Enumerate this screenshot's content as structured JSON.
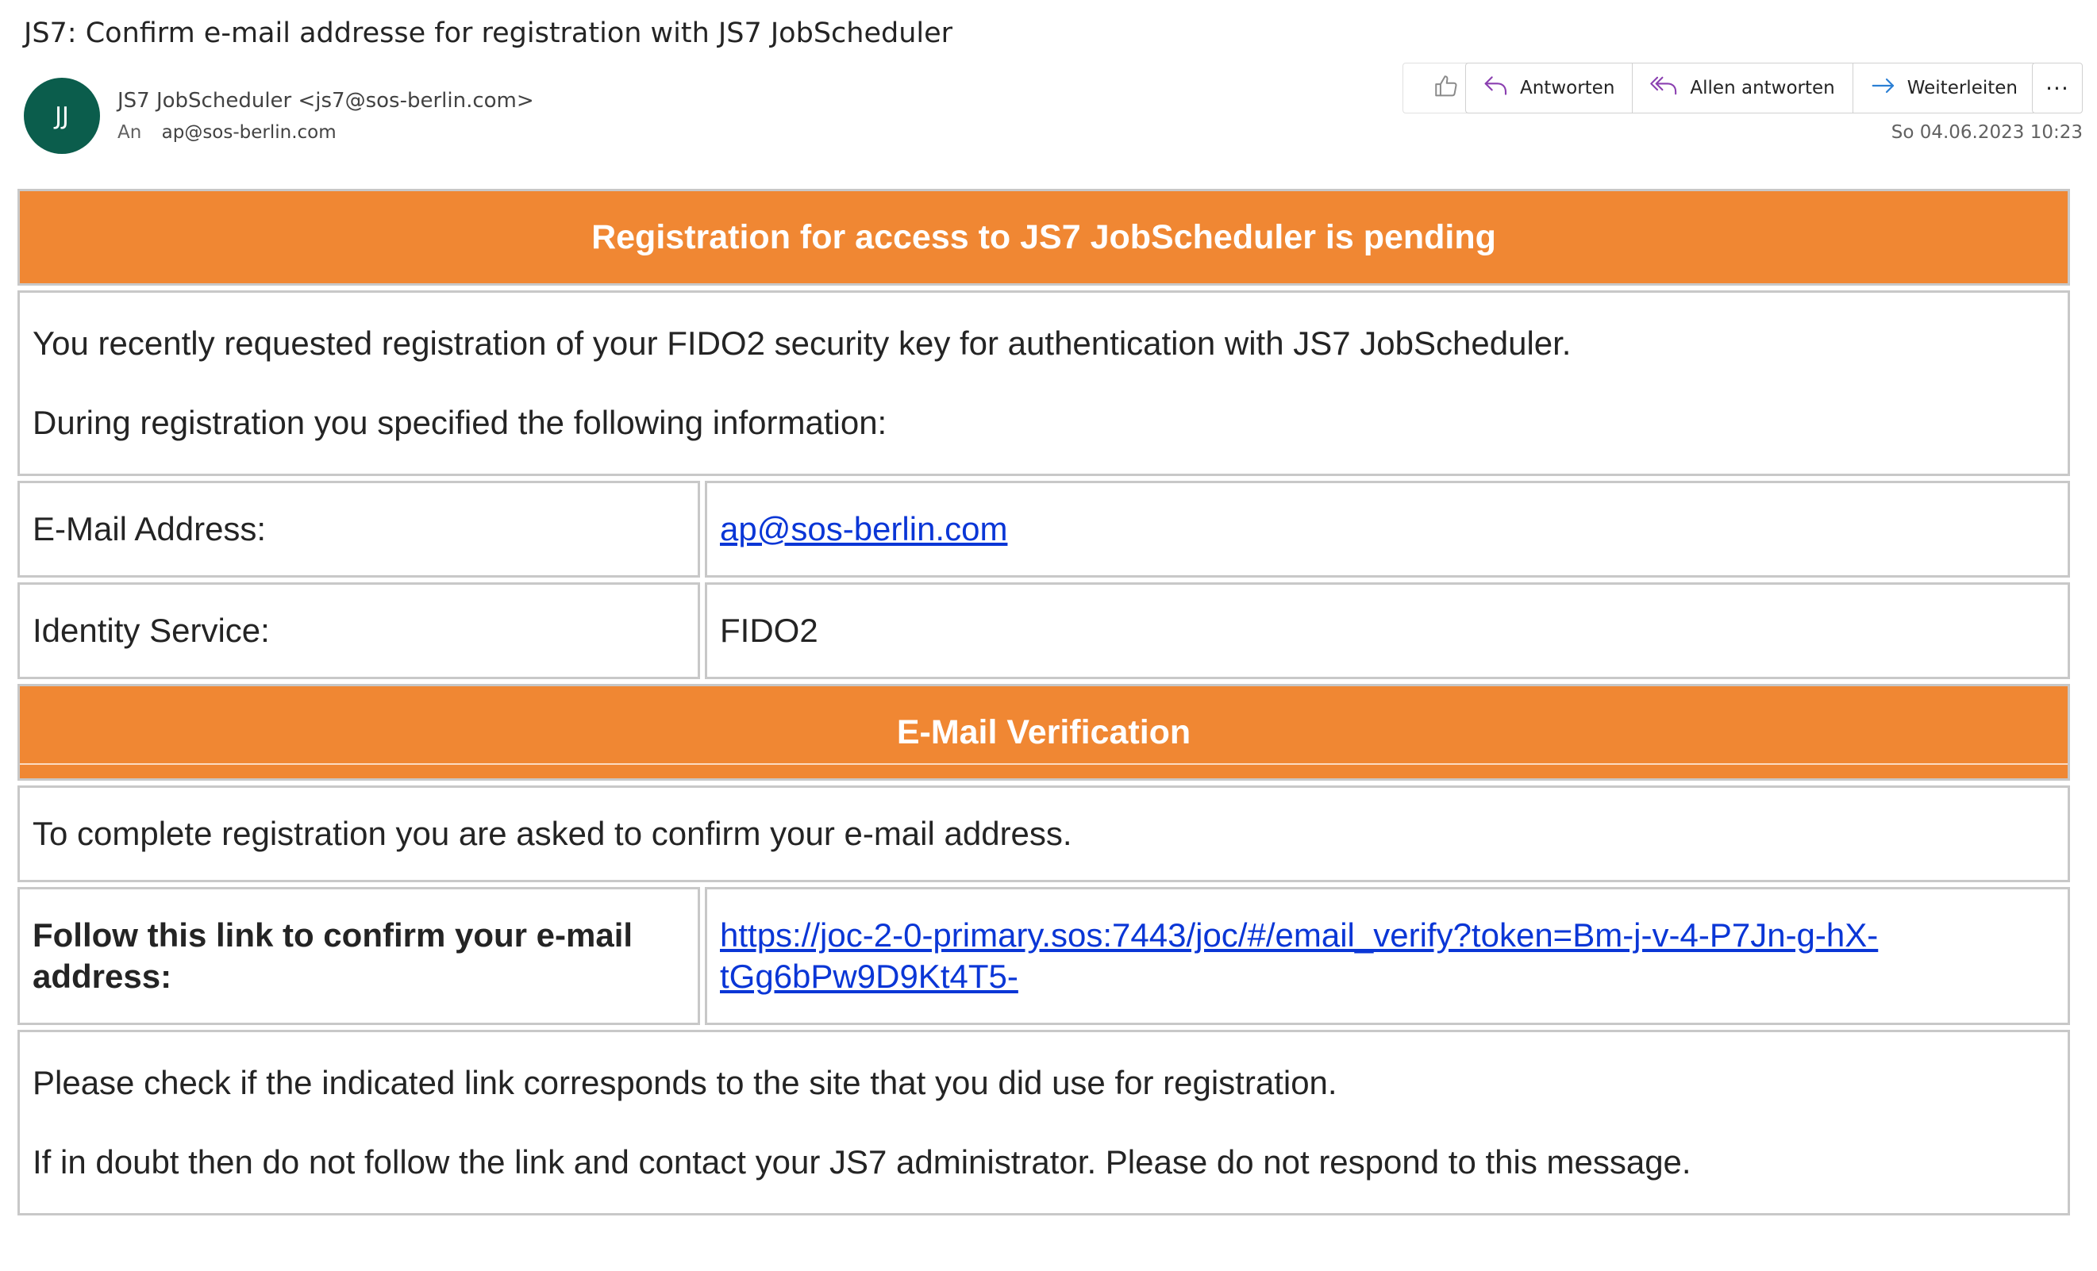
{
  "subject": "JS7: Confirm e-mail addresse for registration with JS7 JobScheduler",
  "sender": {
    "initials": "JJ",
    "name_line": "JS7 JobScheduler <js7@sos-berlin.com>",
    "to_label": "An",
    "to_address": "ap@sos-berlin.com",
    "timestamp": "So 04.06.2023 10:23"
  },
  "actions": {
    "reply": "Antworten",
    "reply_all": "Allen antworten",
    "forward": "Weiterleiten",
    "more": "···"
  },
  "body": {
    "header": "Registration for access to JS7 JobScheduler is pending",
    "intro_line1": "You recently requested registration of your FIDO2 security key for authentication with JS7 JobScheduler.",
    "intro_line2": "During registration you specified the following information:",
    "email_label": "E-Mail Address:",
    "email_value": "ap@sos-berlin.com",
    "identity_label": "Identity Service:",
    "identity_value": "FIDO2",
    "verification_header": "E-Mail Verification",
    "verification_text": "To complete registration you are asked to confirm your e-mail address.",
    "follow_label": "Follow this link to confirm your e-mail address:",
    "verify_link_line1": "https://joc-2-0-primary.sos:7443/joc/#/email_verify?token=Bm-j-v-4-P7Jn-g-hX-",
    "verify_link_line2": "tGg6bPw9D9Kt4T5-",
    "note_line1": "Please check if the indicated link corresponds to the site that you did use for registration.",
    "note_line2": "If in doubt then do not follow the link and contact your JS7 administrator. Please do not respond to this message."
  },
  "colors": {
    "accent_orange": "#f08733",
    "avatar_green": "#0b5d4c",
    "link_blue": "#0a36d6",
    "reply_icon": "#8a3fb0",
    "forward_icon": "#2b7fd4"
  }
}
